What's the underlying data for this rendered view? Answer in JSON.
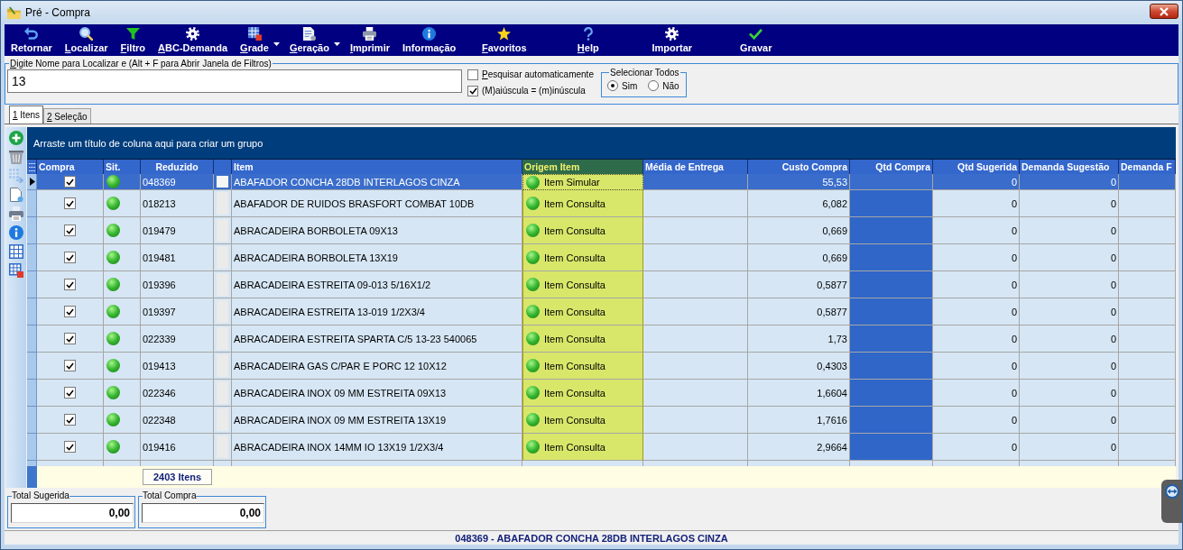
{
  "window": {
    "title": "Pré - Compra"
  },
  "toolbar": {
    "buttons": [
      {
        "label": "Retornar",
        "underline_first": false,
        "has_dropdown": false
      },
      {
        "label": "Localizar",
        "underline_first": true,
        "has_dropdown": false
      },
      {
        "label": "Filtro",
        "underline_first": true,
        "has_dropdown": false
      },
      {
        "label": "ABC-Demanda",
        "underline_first": true,
        "has_dropdown": false
      },
      {
        "label": "Grade",
        "underline_first": true,
        "has_dropdown": true
      },
      {
        "label": "Geração",
        "underline_first": true,
        "has_dropdown": true
      },
      {
        "label": "Imprimir",
        "underline_first": true,
        "has_dropdown": false
      },
      {
        "label": "Informação",
        "underline_first": false,
        "has_dropdown": false
      },
      {
        "label": "Favoritos",
        "underline_first": true,
        "has_dropdown": false
      },
      {
        "label": "Help",
        "underline_first": true,
        "has_dropdown": false
      },
      {
        "label": "Importar",
        "underline_first": false,
        "has_dropdown": false
      },
      {
        "label": "Gravar",
        "underline_first": false,
        "has_dropdown": false
      }
    ]
  },
  "search": {
    "label": "Digite Nome para Localizar e (Alt + F para Abrir Janela de Filtros)",
    "underline_first": true,
    "value": "13",
    "options": [
      {
        "label": "Pesquisar automaticamente",
        "underline_first": true,
        "checked": false
      },
      {
        "label": "(M)aiúscula = (m)inúscula",
        "underline_first": false,
        "checked": true
      }
    ],
    "select_all": {
      "title": "Selecionar Todos",
      "choices": [
        {
          "label": "Sim",
          "selected": true
        },
        {
          "label": "Não",
          "selected": false
        }
      ]
    }
  },
  "tabs": [
    {
      "label": "1 Itens",
      "underline_first": true,
      "selected": true
    },
    {
      "label": "2 Seleção",
      "underline_first": true,
      "selected": false
    }
  ],
  "side_toolbar": {
    "buttons": [
      {
        "disabled": false
      },
      {
        "disabled": false
      },
      {
        "disabled": true
      },
      {
        "disabled": false
      },
      {
        "disabled": false
      },
      {
        "disabled": false
      },
      {
        "disabled": false
      },
      {
        "disabled": false
      }
    ]
  },
  "grid": {
    "group_hint": "Arraste um título de coluna aqui para criar um grupo",
    "columns": [
      {
        "label": "Compra",
        "highlighted": false,
        "editable": false
      },
      {
        "label": "Sit.",
        "highlighted": false,
        "editable": false
      },
      {
        "label": "Reduzido",
        "highlighted": false,
        "editable": false
      },
      {
        "label": "Item",
        "highlighted": false,
        "editable": false
      },
      {
        "label": "Origem Item",
        "highlighted": true,
        "editable": false
      },
      {
        "label": "Média de Entrega",
        "highlighted": false,
        "editable": false
      },
      {
        "label": "Custo Compra",
        "highlighted": false,
        "editable": false
      },
      {
        "label": "Qtd Compra",
        "highlighted": false,
        "editable": true
      },
      {
        "label": "Qtd Sugerida",
        "highlighted": false,
        "editable": false
      },
      {
        "label": "Demanda Sugestão",
        "highlighted": false,
        "editable": false
      },
      {
        "label": "Demanda F",
        "highlighted": false,
        "editable": false
      }
    ],
    "rows": [
      {
        "selected": true,
        "compra": true,
        "reduzido": "048369",
        "item": "ABAFADOR CONCHA 28DB INTERLAGOS CINZA",
        "origem": "Item Simular",
        "custo_compra": "55,53",
        "qtd_sugerida": "0",
        "demanda_sugestao": "0"
      },
      {
        "selected": false,
        "compra": true,
        "reduzido": "018213",
        "item": "ABAFADOR DE RUIDOS BRASFORT COMBAT 10DB",
        "origem": "Item Consulta",
        "custo_compra": "6,082",
        "qtd_sugerida": "0",
        "demanda_sugestao": "0"
      },
      {
        "selected": false,
        "compra": true,
        "reduzido": "019479",
        "item": "ABRACADEIRA BORBOLETA 09X13",
        "origem": "Item Consulta",
        "custo_compra": "0,669",
        "qtd_sugerida": "0",
        "demanda_sugestao": "0"
      },
      {
        "selected": false,
        "compra": true,
        "reduzido": "019481",
        "item": "ABRACADEIRA BORBOLETA 13X19",
        "origem": "Item Consulta",
        "custo_compra": "0,669",
        "qtd_sugerida": "0",
        "demanda_sugestao": "0"
      },
      {
        "selected": false,
        "compra": true,
        "reduzido": "019396",
        "item": "ABRACADEIRA ESTREITA 09-013 5/16X1/2",
        "origem": "Item Consulta",
        "custo_compra": "0,5877",
        "qtd_sugerida": "0",
        "demanda_sugestao": "0"
      },
      {
        "selected": false,
        "compra": true,
        "reduzido": "019397",
        "item": "ABRACADEIRA ESTREITA 13-019 1/2X3/4",
        "origem": "Item Consulta",
        "custo_compra": "0,5877",
        "qtd_sugerida": "0",
        "demanda_sugestao": "0"
      },
      {
        "selected": false,
        "compra": true,
        "reduzido": "022339",
        "item": "ABRACADEIRA ESTREITA SPARTA C/5 13-23 540065",
        "origem": "Item Consulta",
        "custo_compra": "1,73",
        "qtd_sugerida": "0",
        "demanda_sugestao": "0"
      },
      {
        "selected": false,
        "compra": true,
        "reduzido": "019413",
        "item": "ABRACADEIRA GAS C/PAR E PORC 12 10X12",
        "origem": "Item Consulta",
        "custo_compra": "0,4303",
        "qtd_sugerida": "0",
        "demanda_sugestao": "0"
      },
      {
        "selected": false,
        "compra": true,
        "reduzido": "022346",
        "item": "ABRACADEIRA INOX 09 MM ESTREITA 09X13",
        "origem": "Item Consulta",
        "custo_compra": "1,6604",
        "qtd_sugerida": "0",
        "demanda_sugestao": "0"
      },
      {
        "selected": false,
        "compra": true,
        "reduzido": "022348",
        "item": "ABRACADEIRA INOX 09 MM ESTREITA 13X19",
        "origem": "Item Consulta",
        "custo_compra": "1,7616",
        "qtd_sugerida": "0",
        "demanda_sugestao": "0"
      },
      {
        "selected": false,
        "compra": true,
        "reduzido": "019416",
        "item": "ABRACADEIRA INOX 14MM IO 13X19 1/2X3/4",
        "origem": "Item Consulta",
        "custo_compra": "2,9664",
        "qtd_sugerida": "0",
        "demanda_sugestao": "0"
      }
    ],
    "footer_count": "2403 Itens"
  },
  "totals": [
    {
      "label": "Total Sugerida",
      "value": "0,00"
    },
    {
      "label": "Total Compra",
      "value": "0,00"
    }
  ],
  "status_bar": {
    "text": "048369 - ABAFADOR CONCHA 28DB INTERLAGOS CINZA"
  }
}
